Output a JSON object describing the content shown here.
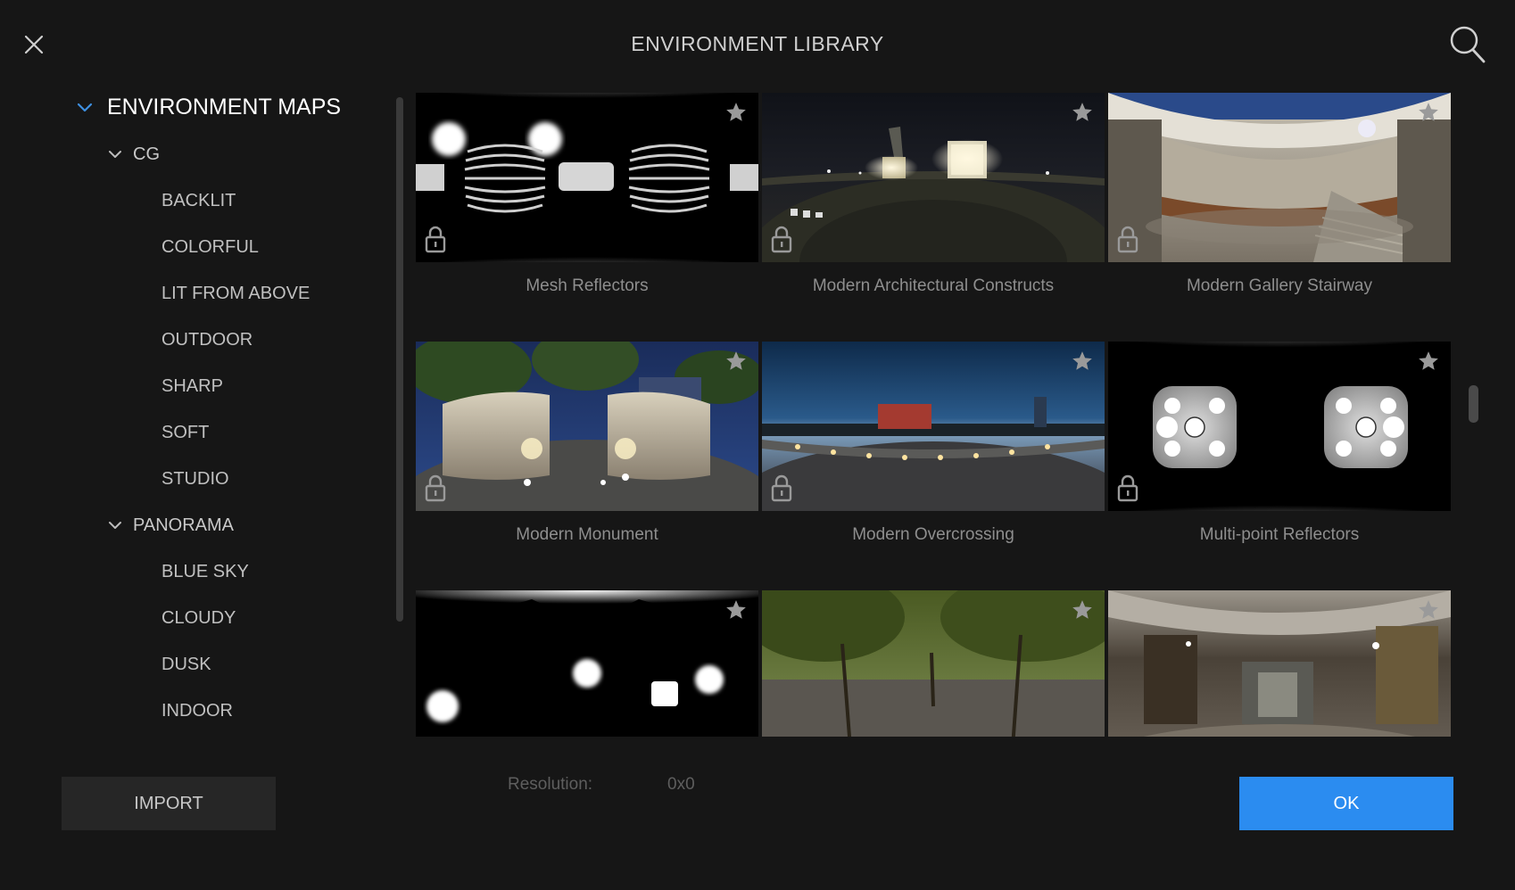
{
  "header": {
    "title": "ENVIRONMENT LIBRARY",
    "close_icon": "close-icon",
    "search_icon": "search-icon"
  },
  "tree": {
    "root": {
      "label": "ENVIRONMENT MAPS",
      "expanded": true
    },
    "groups": [
      {
        "label": "CG",
        "expanded": true,
        "items": [
          "BACKLIT",
          "COLORFUL",
          "LIT FROM ABOVE",
          "OUTDOOR",
          "SHARP",
          "SOFT",
          "STUDIO"
        ]
      },
      {
        "label": "PANORAMA",
        "expanded": true,
        "items": [
          "BLUE SKY",
          "CLOUDY",
          "DUSK",
          "INDOOR"
        ]
      }
    ]
  },
  "grid": {
    "cards": [
      {
        "name": "Mesh Reflectors",
        "locked": true,
        "favorite": false
      },
      {
        "name": "Modern Architectural Constructs",
        "locked": true,
        "favorite": false
      },
      {
        "name": "Modern Gallery Stairway",
        "locked": true,
        "favorite": false
      },
      {
        "name": "Modern Monument",
        "locked": true,
        "favorite": false
      },
      {
        "name": "Modern Overcrossing",
        "locked": true,
        "favorite": false
      },
      {
        "name": "Multi-point Reflectors",
        "locked": true,
        "favorite": false
      },
      {
        "name": "",
        "locked": true,
        "favorite": false
      },
      {
        "name": "",
        "locked": true,
        "favorite": false
      },
      {
        "name": "",
        "locked": true,
        "favorite": false
      }
    ]
  },
  "footer": {
    "import_label": "IMPORT",
    "resolution_label": "Resolution:",
    "resolution_value": "0x0",
    "ok_label": "OK"
  },
  "colors": {
    "background": "#161616",
    "accent": "#2b8cf0",
    "chevron": "#3d8fe0"
  }
}
